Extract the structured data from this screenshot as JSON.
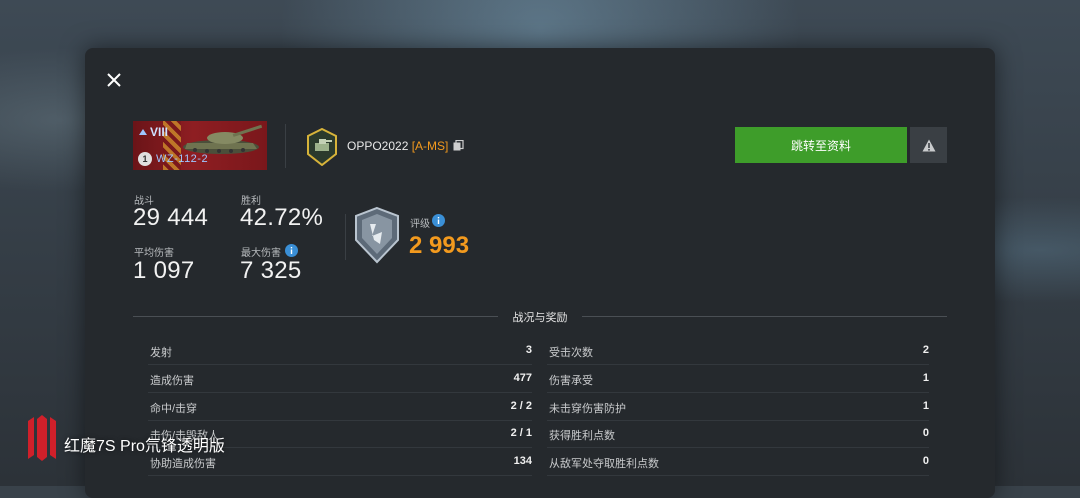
{
  "tank": {
    "tier": "VIII",
    "name": "WZ-112-2",
    "mastery": "1"
  },
  "player": {
    "name": "OPPO2022",
    "clan": "[A-MS]"
  },
  "actions": {
    "profile_label": "跳转至资料"
  },
  "stats": {
    "battles_label": "战斗",
    "battles_value": "29 444",
    "wins_label": "胜利",
    "wins_value": "42.72%",
    "avg_damage_label": "平均伤害",
    "avg_damage_value": "1 097",
    "max_damage_label": "最大伤害",
    "max_damage_value": "7 325"
  },
  "rating": {
    "label": "评级",
    "value": "2 993"
  },
  "section": {
    "title": "战况与奖励"
  },
  "left_rows": [
    {
      "label": "发射",
      "value": "3"
    },
    {
      "label": "造成伤害",
      "value": "477"
    },
    {
      "label": "命中/击穿",
      "value": "2 / 2"
    },
    {
      "label": "击伤/击毁敌人",
      "value": "2 / 1"
    },
    {
      "label": "协助造成伤害",
      "value": "134"
    }
  ],
  "right_rows": [
    {
      "label": "受击次数",
      "value": "2"
    },
    {
      "label": "伤害承受",
      "value": "1"
    },
    {
      "label": "未击穿伤害防护",
      "value": "1"
    },
    {
      "label": "获得胜利点数",
      "value": "0"
    },
    {
      "label": "从敌军处夺取胜利点数",
      "value": "0"
    }
  ],
  "watermark": {
    "text": "红魔7S Pro氘锋透明版"
  },
  "colors": {
    "accent": "#f39a1e",
    "button_green": "#3e9d2a",
    "panel": "#25292d"
  },
  "icons": [
    "close-icon",
    "copy-icon",
    "warning-icon",
    "info-icon",
    "rating-badge-icon",
    "clan-emblem-icon",
    "tank-icon"
  ]
}
